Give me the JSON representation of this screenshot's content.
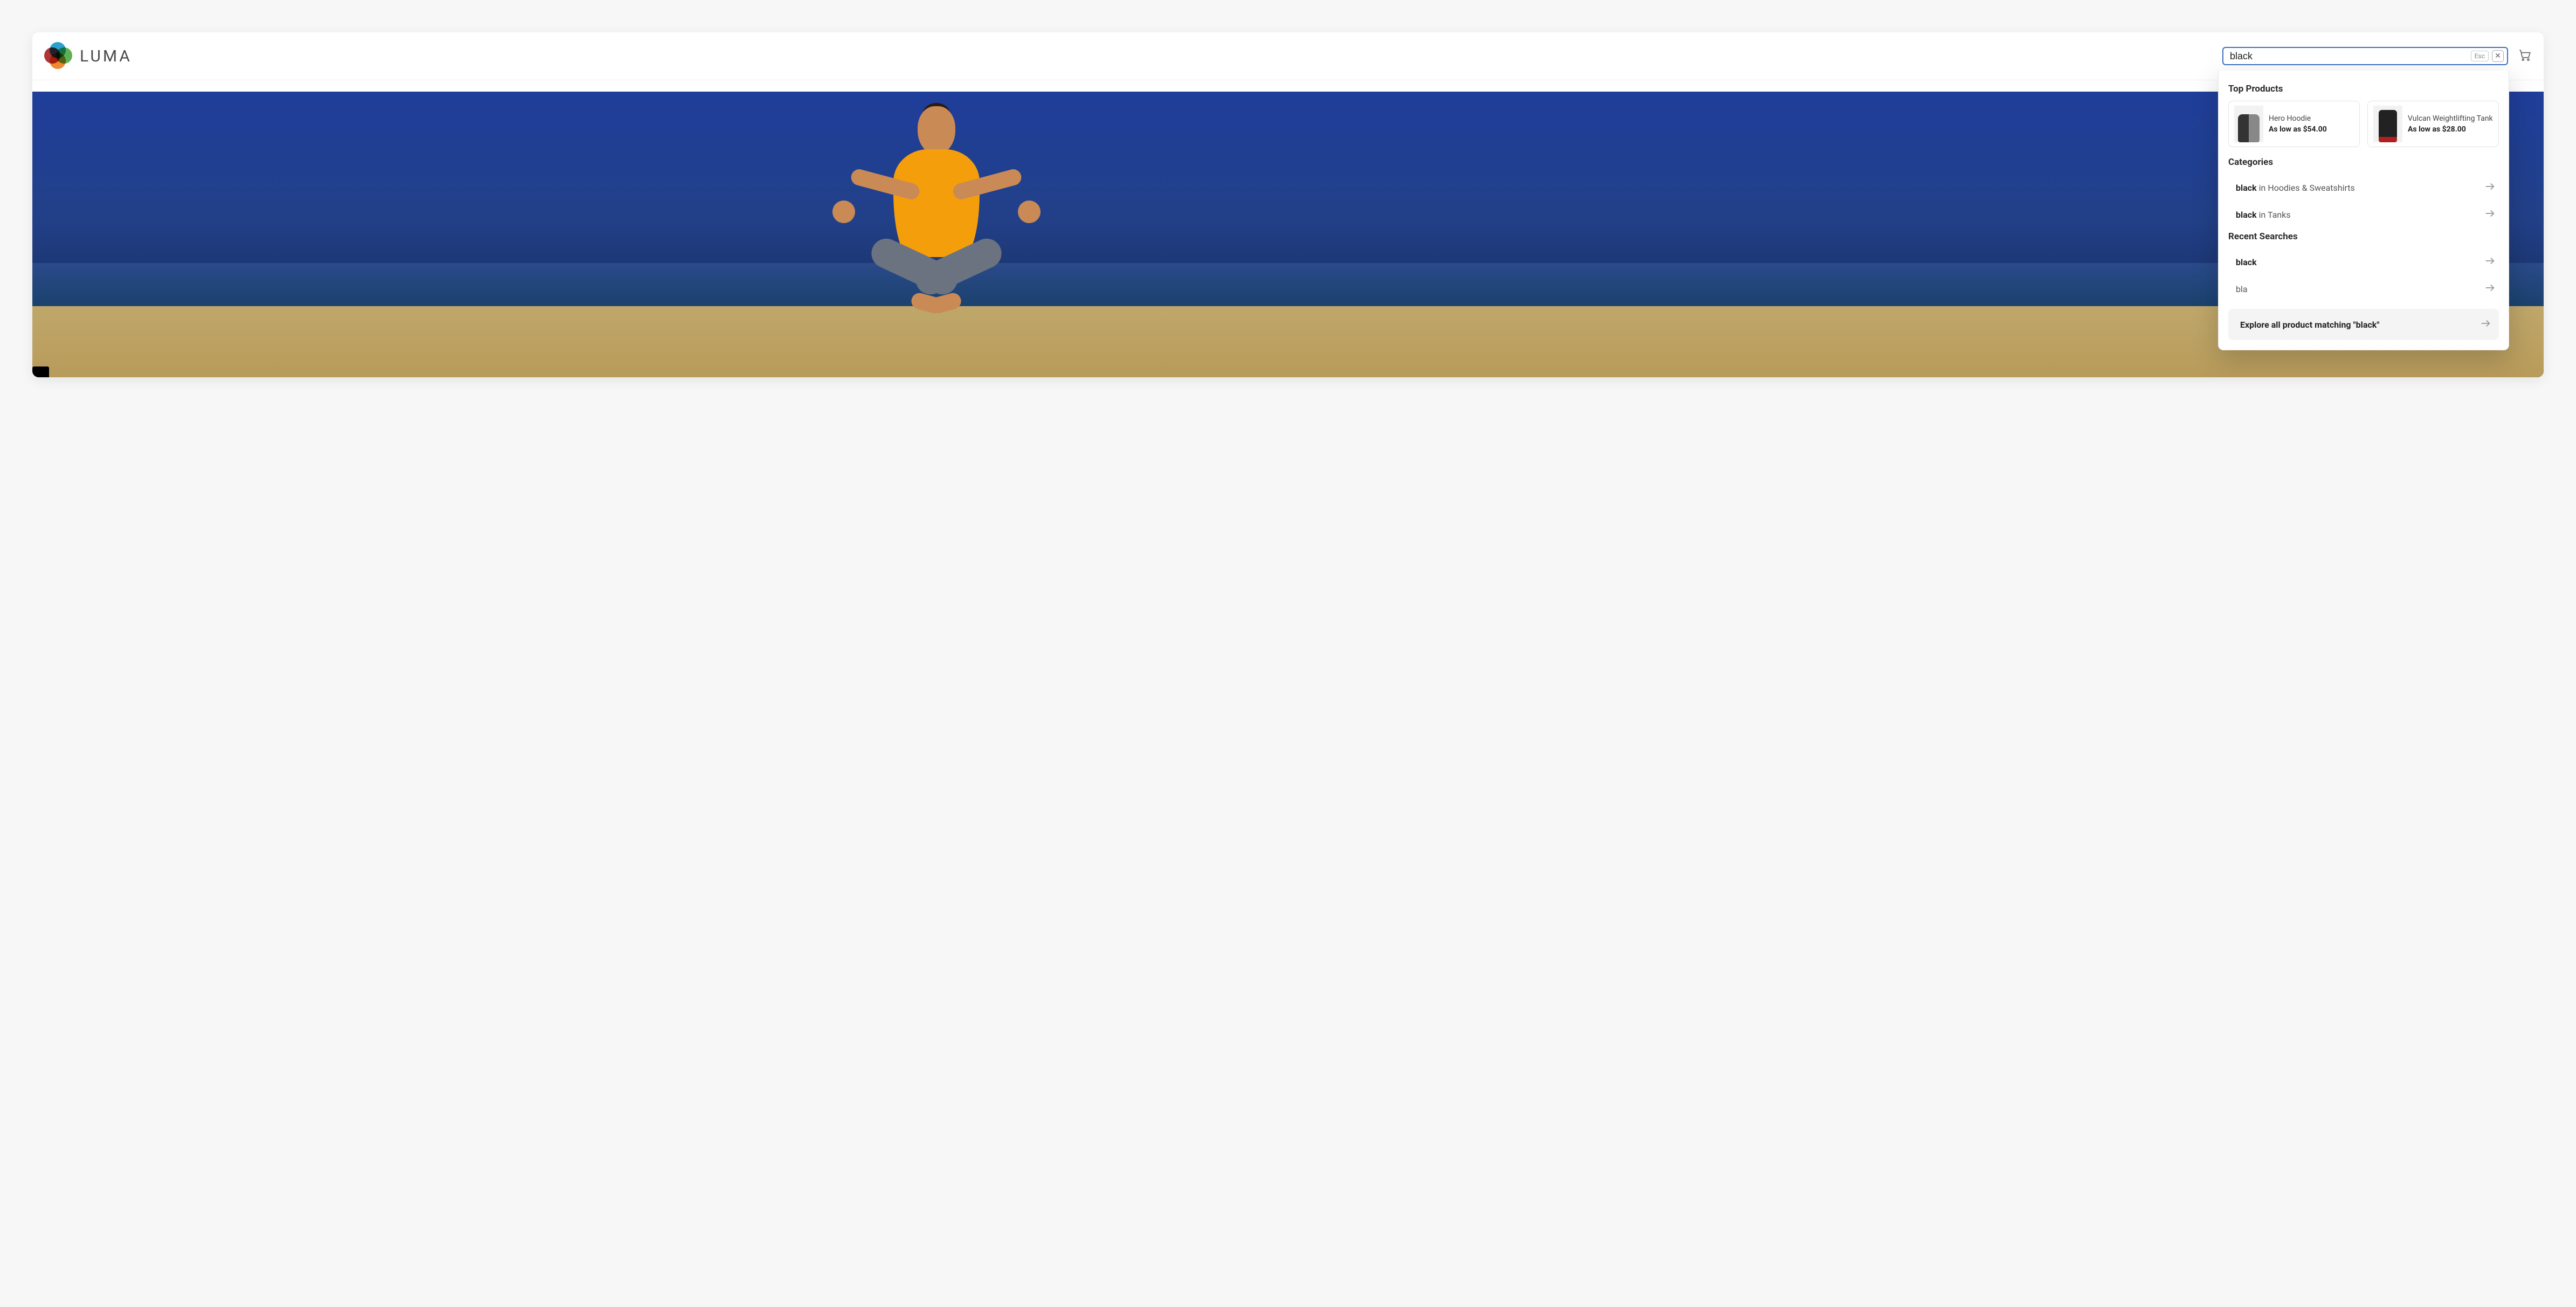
{
  "brand": {
    "name": "LUMA"
  },
  "search": {
    "value": "black",
    "esc_label": "Esc"
  },
  "dropdown": {
    "sections": {
      "top_products_title": "Top Products",
      "categories_title": "Categories",
      "recent_title": "Recent Searches"
    },
    "top_products": [
      {
        "name": "Hero Hoodie",
        "price": "As low as $54.00",
        "thumb": "hoodie"
      },
      {
        "name": "Vulcan Weightlifting Tank",
        "price": "As low as $28.00",
        "thumb": "tank"
      }
    ],
    "categories": [
      {
        "query": "black",
        "suffix": " in Hoodies & Sweatshirts"
      },
      {
        "query": "black",
        "suffix": " in Tanks"
      }
    ],
    "recent": [
      {
        "text": "black",
        "bold": true
      },
      {
        "text": "bla",
        "bold": false
      }
    ],
    "explore_label": "Explore all product matching \"black\""
  }
}
